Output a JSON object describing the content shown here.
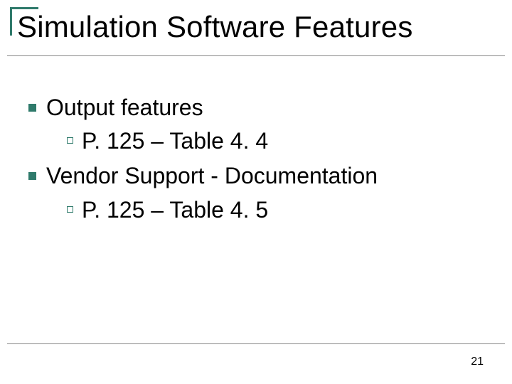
{
  "title": "Simulation Software Features",
  "bullets": [
    {
      "text": "Output features",
      "children": [
        {
          "text": "P. 125 – Table 4. 4"
        }
      ]
    },
    {
      "text": "Vendor Support - Documentation",
      "children": [
        {
          "text": "P. 125 – Table 4. 5"
        }
      ]
    }
  ],
  "page_number": "21"
}
